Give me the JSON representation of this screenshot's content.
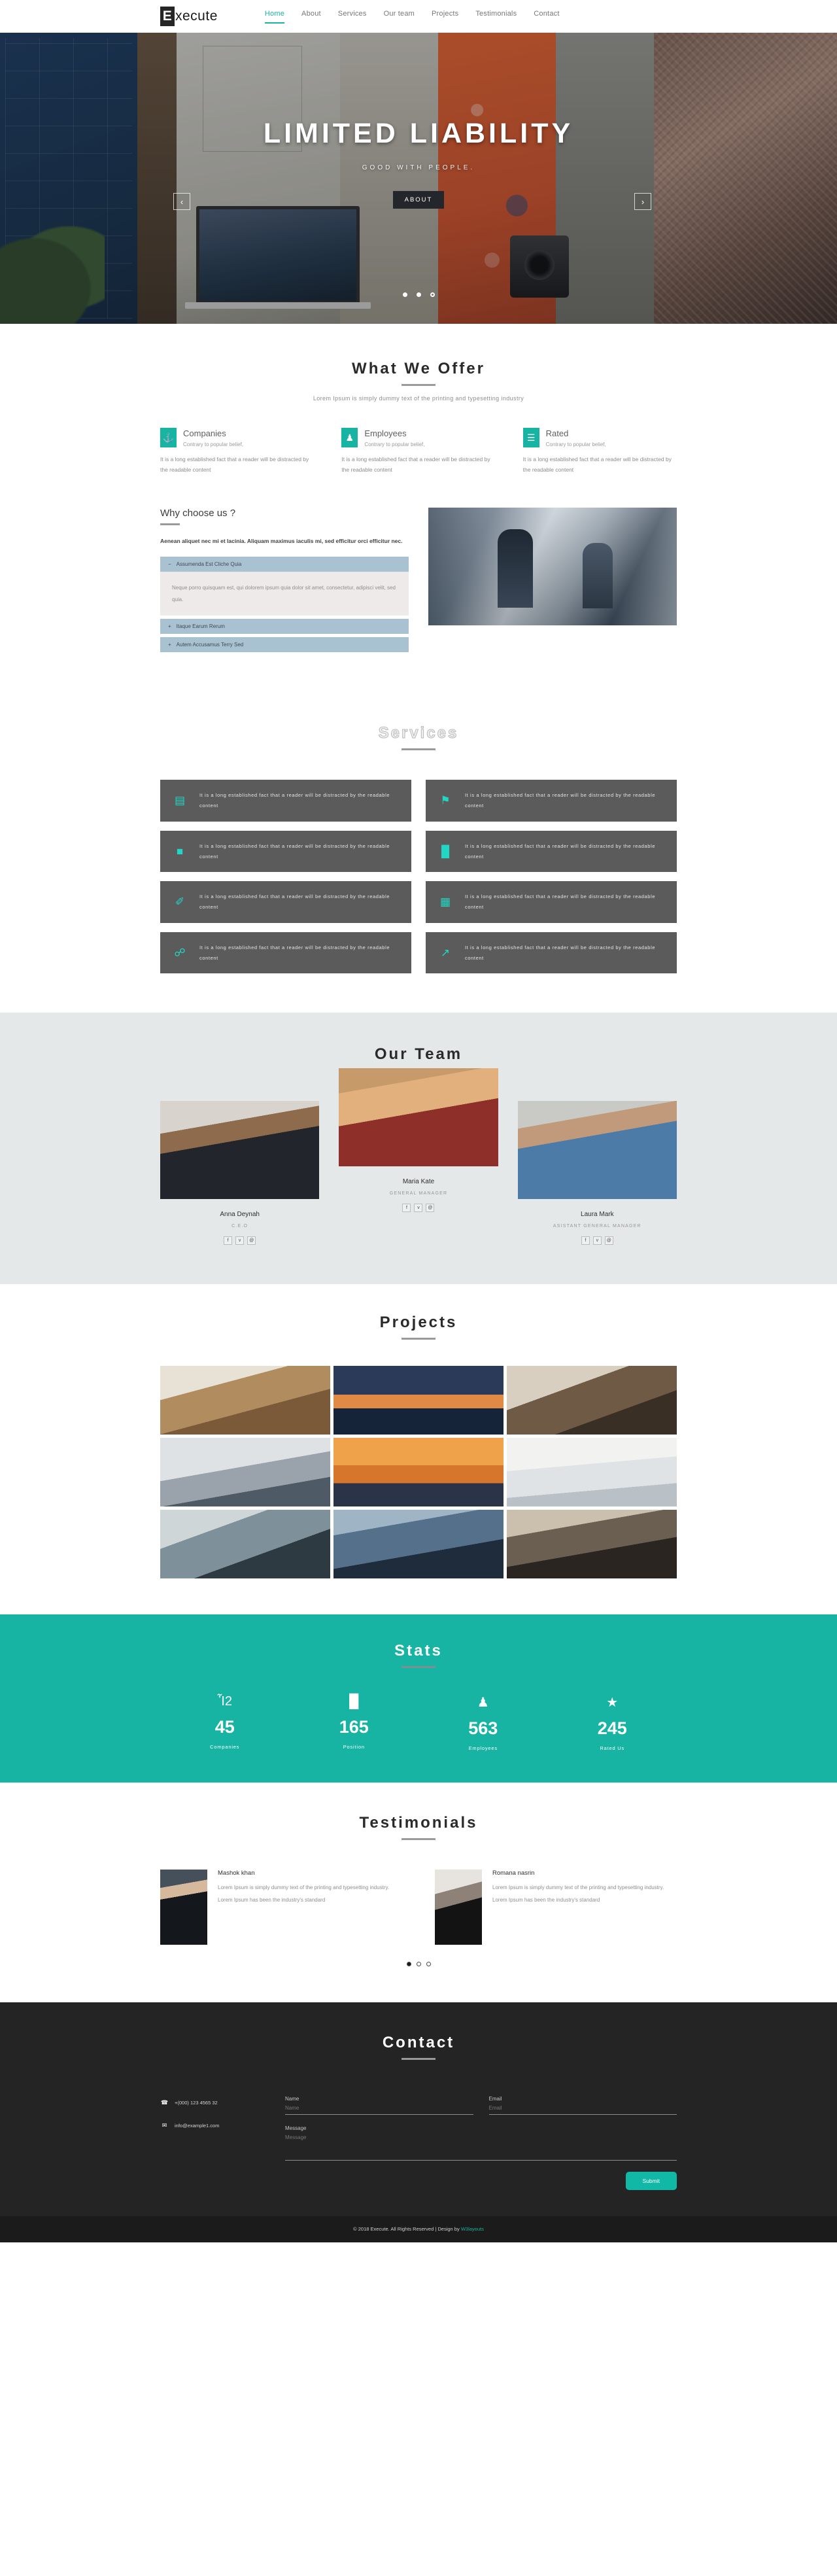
{
  "header": {
    "logo_badge": "E",
    "logo_rest": "xecute",
    "nav": [
      {
        "label": "Home",
        "active": true
      },
      {
        "label": "About",
        "active": false
      },
      {
        "label": "Services",
        "active": false
      },
      {
        "label": "Our team",
        "active": false
      },
      {
        "label": "Projects",
        "active": false
      },
      {
        "label": "Testimonials",
        "active": false
      },
      {
        "label": "Contact",
        "active": false
      }
    ]
  },
  "hero": {
    "title": "LIMITED LIABILITY",
    "subtitle": "GOOD WITH PEOPLE.",
    "button": "ABOUT",
    "prev_arrow": "‹",
    "next_arrow": "›"
  },
  "offer": {
    "title": "What We Offer",
    "subtitle": "Lorem Ipsum is simply dummy text of the printing and typesetting industry",
    "cards": [
      {
        "icon": "⚓",
        "icon_name": "anchor-icon",
        "name": "Companies",
        "tagline": "Contrary to popular belief,",
        "body": "It is a long established fact that a reader will be distracted by the readable content"
      },
      {
        "icon": "♟",
        "icon_name": "users-group-icon",
        "name": "Employees",
        "tagline": "Contrary to popular belief,",
        "body": "It is a long established fact that a reader will be distracted by the readable content"
      },
      {
        "icon": "☰",
        "icon_name": "clipboard-icon",
        "name": "Rated",
        "tagline": "Contrary to popular belief,",
        "body": "It is a long established fact that a reader will be distracted by the readable content"
      }
    ]
  },
  "why": {
    "title": "Why choose us ?",
    "lead": "Aenean aliquet nec mi et lacinia. Aliquam maximus iaculis mi, sed efficitur orci efficitur nec.",
    "accordion": [
      {
        "sign": "−",
        "label": "Assumenda Est Cliche Quia",
        "open": true,
        "body": "Neque porro quisquam est, qui dolorem ipsum quia dolor sit amet, consectetur, adipisci velit, sed quia."
      },
      {
        "sign": "+",
        "label": "Itaque Earum Rerum",
        "open": false,
        "body": ""
      },
      {
        "sign": "+",
        "label": "Autem Accusamus Terry Sed",
        "open": false,
        "body": ""
      }
    ]
  },
  "services": {
    "title": "Services",
    "items": [
      {
        "icon": "▤",
        "icon_name": "book-icon",
        "text": "It is a long established fact that a reader will be distracted by the readable content"
      },
      {
        "icon": "⚑",
        "icon_name": "flag-icon",
        "text": "It is a long established fact that a reader will be distracted by the readable content"
      },
      {
        "icon": "■",
        "icon_name": "briefcase-icon",
        "text": "It is a long established fact that a reader will be distracted by the readable content"
      },
      {
        "icon": "█",
        "icon_name": "bar-chart-icon",
        "text": "It is a long established fact that a reader will be distracted by the readable content"
      },
      {
        "icon": "✐",
        "icon_name": "pen-icon",
        "text": "It is a long established fact that a reader will be distracted by the readable content"
      },
      {
        "icon": "▦",
        "icon_name": "calendar-icon",
        "text": "It is a long established fact that a reader will be distracted by the readable content"
      },
      {
        "icon": "☍",
        "icon_name": "lock-icon",
        "text": "It is a long established fact that a reader will be distracted by the readable content"
      },
      {
        "icon": "↗",
        "icon_name": "external-link-icon",
        "text": "It is a long established fact that a reader will be distracted by the readable content"
      }
    ]
  },
  "team": {
    "title": "Our Team",
    "members": [
      {
        "name": "Anna Deynah",
        "role": "C.E.O",
        "social": [
          {
            "glyph": "f",
            "name": "facebook-icon"
          },
          {
            "glyph": "ᴠ",
            "name": "twitter-icon"
          },
          {
            "glyph": "@",
            "name": "dribbble-icon"
          }
        ]
      },
      {
        "name": "Maria Kate",
        "role": "GENERAL MANAGER",
        "social": [
          {
            "glyph": "f",
            "name": "facebook-icon"
          },
          {
            "glyph": "ᴠ",
            "name": "twitter-icon"
          },
          {
            "glyph": "@",
            "name": "dribbble-icon"
          }
        ]
      },
      {
        "name": "Laura Mark",
        "role": "ASISTANT GENERAL MANAGER",
        "social": [
          {
            "glyph": "f",
            "name": "facebook-icon"
          },
          {
            "glyph": "ᴠ",
            "name": "twitter-icon"
          },
          {
            "glyph": "@",
            "name": "dribbble-icon"
          }
        ]
      }
    ]
  },
  "projects": {
    "title": "Projects",
    "count": 9
  },
  "stats": {
    "title": "Stats",
    "items": [
      {
        "icon": "Ἶ2",
        "icon_name": "building-icon",
        "value": "45",
        "label": "Companies"
      },
      {
        "icon": "█",
        "icon_name": "bar-chart-icon",
        "value": "165",
        "label": "Position"
      },
      {
        "icon": "♟",
        "icon_name": "users-group-icon",
        "value": "563",
        "label": "Employees"
      },
      {
        "icon": "★",
        "icon_name": "star-icon",
        "value": "245",
        "label": "Rated Us"
      }
    ]
  },
  "testimonials": {
    "title": "Testimonials",
    "items": [
      {
        "name": "Mashok khan",
        "text": "Lorem Ipsum is simply dummy text of the printing and typesetting industry. Lorem Ipsum has been the industry's standard"
      },
      {
        "name": "Romana nasrin",
        "text": "Lorem Ipsum is simply dummy text of the printing and typesetting industry. Lorem Ipsum has been the industry's standard"
      }
    ],
    "dots": [
      true,
      false,
      false
    ]
  },
  "contact": {
    "title": "Contact",
    "phone": "+(000) 123 4565 32",
    "phone_icon": "☎",
    "email": "info@example1.com",
    "email_icon": "✉",
    "name_label": "Name",
    "email_label": "Email",
    "message_label": "Message",
    "submit_label": "Submit"
  },
  "footer": {
    "text": "© 2018 Execute. All Rights Reserved | Design by ",
    "link": "W3layouts"
  },
  "colors": {
    "accent": "#17b3a3",
    "dark": "#242424",
    "service_box": "#5b5b5b",
    "accordion_head": "#a9c2d1"
  }
}
